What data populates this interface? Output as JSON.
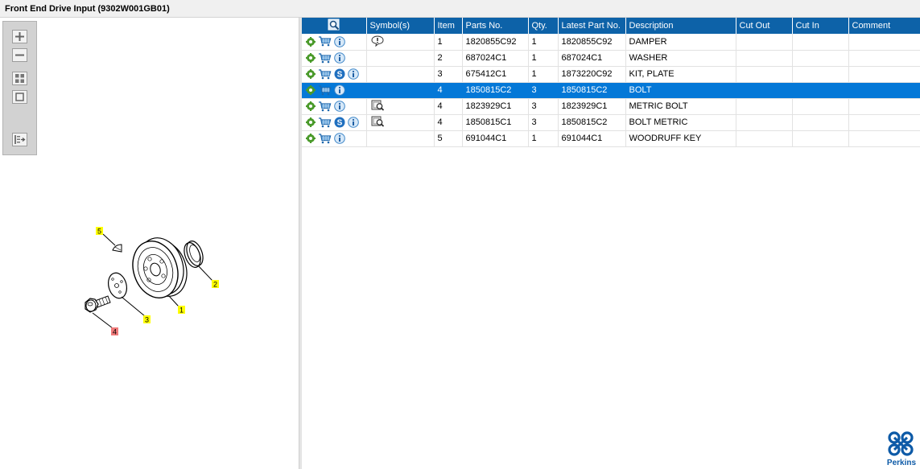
{
  "window": {
    "title": "Front End Drive Input (9302W001GB01)"
  },
  "diagram": {
    "callouts": [
      {
        "label": "5",
        "color": "#ffff00"
      },
      {
        "label": "2",
        "color": "#ffff00"
      },
      {
        "label": "1",
        "color": "#ffff00"
      },
      {
        "label": "3",
        "color": "#ffff00"
      },
      {
        "label": "4",
        "color": "#f07a7a"
      }
    ]
  },
  "table": {
    "columns": [
      "",
      "Symbol(s)",
      "Item",
      "Parts No.",
      "Qty.",
      "Latest Part No.",
      "Description",
      "Cut Out",
      "Cut In",
      "Comment"
    ],
    "rows": [
      {
        "item": "1",
        "parts_no": "1820855C92",
        "qty": "1",
        "latest_part_no": "1820855C92",
        "description": "DAMPER",
        "cut_out": "",
        "cut_in": "",
        "comment": "",
        "has_s": false,
        "symbol": "exclamation-bubble-icon",
        "selected": false
      },
      {
        "item": "2",
        "parts_no": "687024C1",
        "qty": "1",
        "latest_part_no": "687024C1",
        "description": "WASHER",
        "cut_out": "",
        "cut_in": "",
        "comment": "",
        "has_s": false,
        "symbol": "",
        "selected": false
      },
      {
        "item": "3",
        "parts_no": "675412C1",
        "qty": "1",
        "latest_part_no": "1873220C92",
        "description": "KIT, PLATE",
        "cut_out": "",
        "cut_in": "",
        "comment": "",
        "has_s": true,
        "symbol": "",
        "selected": false
      },
      {
        "item": "4",
        "parts_no": "1850815C2",
        "qty": "3",
        "latest_part_no": "1850815C2",
        "description": "BOLT",
        "cut_out": "",
        "cut_in": "",
        "comment": "",
        "has_s": false,
        "symbol": "",
        "selected": true
      },
      {
        "item": "4",
        "parts_no": "1823929C1",
        "qty": "3",
        "latest_part_no": "1823929C1",
        "description": "METRIC BOLT",
        "cut_out": "",
        "cut_in": "",
        "comment": "",
        "has_s": false,
        "symbol": "alternate-icon",
        "selected": false
      },
      {
        "item": "4",
        "parts_no": "1850815C1",
        "qty": "3",
        "latest_part_no": "1850815C2",
        "description": "BOLT METRIC",
        "cut_out": "",
        "cut_in": "",
        "comment": "",
        "has_s": true,
        "symbol": "alternate-icon",
        "selected": false
      },
      {
        "item": "5",
        "parts_no": "691044C1",
        "qty": "1",
        "latest_part_no": "691044C1",
        "description": "WOODRUFF KEY",
        "cut_out": "",
        "cut_in": "",
        "comment": "",
        "has_s": false,
        "symbol": "",
        "selected": false
      }
    ]
  },
  "colors": {
    "header": "#0d62a8",
    "selected_row": "#0478d7",
    "brand": "#0d5aa7"
  },
  "brand": {
    "name": "Perkins"
  }
}
